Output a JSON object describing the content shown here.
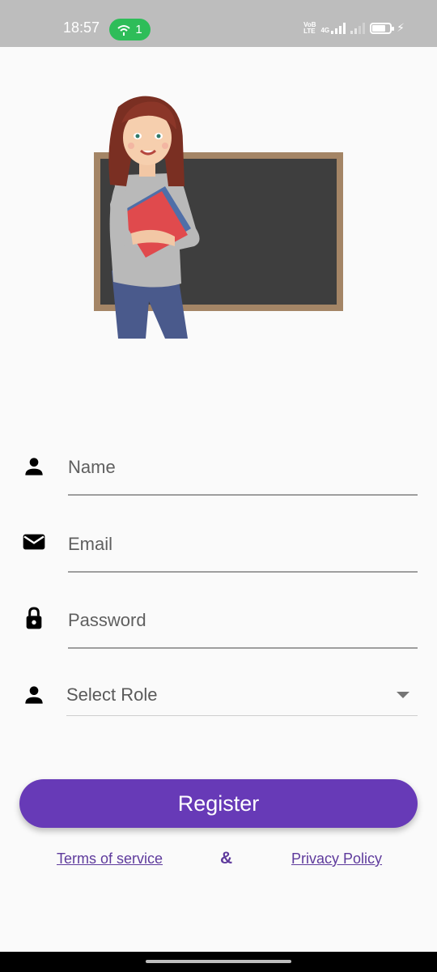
{
  "status_bar": {
    "time": "18:57",
    "hotspot_count": "1",
    "network_label_1": "VoB",
    "network_label_2": "LTE",
    "network_type": "4G"
  },
  "form": {
    "name_placeholder": "Name",
    "email_placeholder": "Email",
    "password_placeholder": "Password",
    "role_value": "Select Role"
  },
  "actions": {
    "register_label": "Register"
  },
  "footer": {
    "terms_label": "Terms of service",
    "ampersand": "&",
    "privacy_label": "Privacy Policy"
  },
  "colors": {
    "primary": "#673ab7",
    "link": "#5e3a9c",
    "hotspot": "#2ebd59",
    "status_bar": "#bdbdbd"
  },
  "icons": {
    "name_field": "person-icon",
    "email_field": "mail-icon",
    "password_field": "lock-icon",
    "role_field": "person-icon",
    "role_dropdown": "caret-down-icon"
  }
}
